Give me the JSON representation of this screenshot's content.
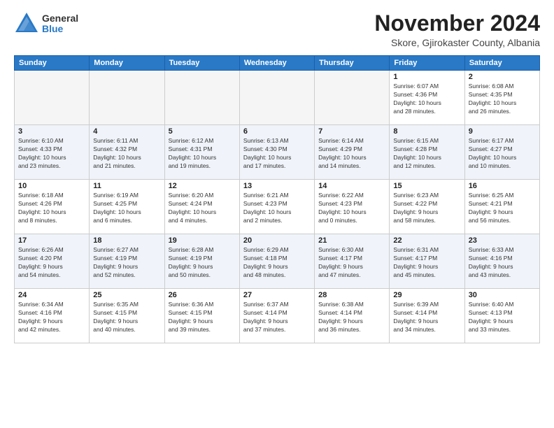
{
  "logo": {
    "general": "General",
    "blue": "Blue"
  },
  "title": "November 2024",
  "subtitle": "Skore, Gjirokaster County, Albania",
  "weekdays": [
    "Sunday",
    "Monday",
    "Tuesday",
    "Wednesday",
    "Thursday",
    "Friday",
    "Saturday"
  ],
  "weeks": [
    [
      {
        "day": "",
        "info": ""
      },
      {
        "day": "",
        "info": ""
      },
      {
        "day": "",
        "info": ""
      },
      {
        "day": "",
        "info": ""
      },
      {
        "day": "",
        "info": ""
      },
      {
        "day": "1",
        "info": "Sunrise: 6:07 AM\nSunset: 4:36 PM\nDaylight: 10 hours\nand 28 minutes."
      },
      {
        "day": "2",
        "info": "Sunrise: 6:08 AM\nSunset: 4:35 PM\nDaylight: 10 hours\nand 26 minutes."
      }
    ],
    [
      {
        "day": "3",
        "info": "Sunrise: 6:10 AM\nSunset: 4:33 PM\nDaylight: 10 hours\nand 23 minutes."
      },
      {
        "day": "4",
        "info": "Sunrise: 6:11 AM\nSunset: 4:32 PM\nDaylight: 10 hours\nand 21 minutes."
      },
      {
        "day": "5",
        "info": "Sunrise: 6:12 AM\nSunset: 4:31 PM\nDaylight: 10 hours\nand 19 minutes."
      },
      {
        "day": "6",
        "info": "Sunrise: 6:13 AM\nSunset: 4:30 PM\nDaylight: 10 hours\nand 17 minutes."
      },
      {
        "day": "7",
        "info": "Sunrise: 6:14 AM\nSunset: 4:29 PM\nDaylight: 10 hours\nand 14 minutes."
      },
      {
        "day": "8",
        "info": "Sunrise: 6:15 AM\nSunset: 4:28 PM\nDaylight: 10 hours\nand 12 minutes."
      },
      {
        "day": "9",
        "info": "Sunrise: 6:17 AM\nSunset: 4:27 PM\nDaylight: 10 hours\nand 10 minutes."
      }
    ],
    [
      {
        "day": "10",
        "info": "Sunrise: 6:18 AM\nSunset: 4:26 PM\nDaylight: 10 hours\nand 8 minutes."
      },
      {
        "day": "11",
        "info": "Sunrise: 6:19 AM\nSunset: 4:25 PM\nDaylight: 10 hours\nand 6 minutes."
      },
      {
        "day": "12",
        "info": "Sunrise: 6:20 AM\nSunset: 4:24 PM\nDaylight: 10 hours\nand 4 minutes."
      },
      {
        "day": "13",
        "info": "Sunrise: 6:21 AM\nSunset: 4:23 PM\nDaylight: 10 hours\nand 2 minutes."
      },
      {
        "day": "14",
        "info": "Sunrise: 6:22 AM\nSunset: 4:23 PM\nDaylight: 10 hours\nand 0 minutes."
      },
      {
        "day": "15",
        "info": "Sunrise: 6:23 AM\nSunset: 4:22 PM\nDaylight: 9 hours\nand 58 minutes."
      },
      {
        "day": "16",
        "info": "Sunrise: 6:25 AM\nSunset: 4:21 PM\nDaylight: 9 hours\nand 56 minutes."
      }
    ],
    [
      {
        "day": "17",
        "info": "Sunrise: 6:26 AM\nSunset: 4:20 PM\nDaylight: 9 hours\nand 54 minutes."
      },
      {
        "day": "18",
        "info": "Sunrise: 6:27 AM\nSunset: 4:19 PM\nDaylight: 9 hours\nand 52 minutes."
      },
      {
        "day": "19",
        "info": "Sunrise: 6:28 AM\nSunset: 4:19 PM\nDaylight: 9 hours\nand 50 minutes."
      },
      {
        "day": "20",
        "info": "Sunrise: 6:29 AM\nSunset: 4:18 PM\nDaylight: 9 hours\nand 48 minutes."
      },
      {
        "day": "21",
        "info": "Sunrise: 6:30 AM\nSunset: 4:17 PM\nDaylight: 9 hours\nand 47 minutes."
      },
      {
        "day": "22",
        "info": "Sunrise: 6:31 AM\nSunset: 4:17 PM\nDaylight: 9 hours\nand 45 minutes."
      },
      {
        "day": "23",
        "info": "Sunrise: 6:33 AM\nSunset: 4:16 PM\nDaylight: 9 hours\nand 43 minutes."
      }
    ],
    [
      {
        "day": "24",
        "info": "Sunrise: 6:34 AM\nSunset: 4:16 PM\nDaylight: 9 hours\nand 42 minutes."
      },
      {
        "day": "25",
        "info": "Sunrise: 6:35 AM\nSunset: 4:15 PM\nDaylight: 9 hours\nand 40 minutes."
      },
      {
        "day": "26",
        "info": "Sunrise: 6:36 AM\nSunset: 4:15 PM\nDaylight: 9 hours\nand 39 minutes."
      },
      {
        "day": "27",
        "info": "Sunrise: 6:37 AM\nSunset: 4:14 PM\nDaylight: 9 hours\nand 37 minutes."
      },
      {
        "day": "28",
        "info": "Sunrise: 6:38 AM\nSunset: 4:14 PM\nDaylight: 9 hours\nand 36 minutes."
      },
      {
        "day": "29",
        "info": "Sunrise: 6:39 AM\nSunset: 4:14 PM\nDaylight: 9 hours\nand 34 minutes."
      },
      {
        "day": "30",
        "info": "Sunrise: 6:40 AM\nSunset: 4:13 PM\nDaylight: 9 hours\nand 33 minutes."
      }
    ]
  ]
}
